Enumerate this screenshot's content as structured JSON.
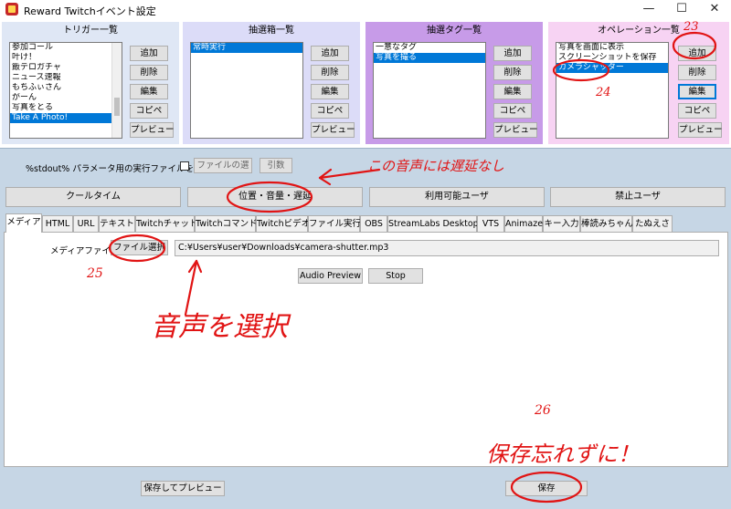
{
  "window": {
    "title": "Reward Twitchイベント設定",
    "controls": [
      "—",
      "☐",
      "✕"
    ]
  },
  "panels": [
    {
      "id": "trigger",
      "header": "トリガー一覧",
      "color": "#dfe7f5",
      "items": [
        "参加コール",
        "叶け！",
        "飯テロガチャ",
        "ニュース速報",
        "もちふぃさん",
        "がーん",
        "写真をとる",
        "Take A Photo!"
      ],
      "selected": 7,
      "buttons": [
        "追加",
        "削除",
        "編集",
        "コピペ",
        "プレビュー"
      ]
    },
    {
      "id": "lottery-box",
      "header": "抽選箱一覧",
      "color": "#dcdcf8",
      "items": [
        "常時実行"
      ],
      "selected": 0,
      "buttons": [
        "追加",
        "削除",
        "編集",
        "コピペ",
        "プレビュー"
      ]
    },
    {
      "id": "lottery-tag",
      "header": "抽選タグ一覧",
      "color": "#c79be8",
      "items": [
        "一意なタグ",
        "写真を撮る"
      ],
      "selected": 1,
      "buttons": [
        "追加",
        "削除",
        "編集",
        "コピペ",
        "プレビュー"
      ]
    },
    {
      "id": "operation",
      "header": "オペレーション一覧",
      "color": "#f7d3f3",
      "items": [
        "写真を画面に表示",
        "スクリーンショットを保存",
        "カメラシャッター"
      ],
      "selected": 2,
      "buttons": [
        "追加",
        "削除",
        "編集",
        "コピペ",
        "プレビュー"
      ]
    }
  ],
  "stdout_row": {
    "label": "%stdout% パラメータ用の実行ファイルを使う",
    "file_button": "ファイルの選",
    "arg_button": "引数"
  },
  "big_buttons": [
    "クールタイム",
    "位置・音量・遅延",
    "利用可能ユーザ",
    "禁止ユーザ"
  ],
  "tabs": [
    "メディア",
    "HTML",
    "URL",
    "テキスト",
    "Twitchチャット",
    "Twitchコマンド",
    "Twitchビデオ",
    "ファイル実行",
    "OBS",
    "StreamLabs Desktop",
    "VTS",
    "Animaze",
    "キー入力",
    "棒読みちゃん",
    "たぬえさ"
  ],
  "active_tab": 0,
  "media": {
    "label": "メディアファイル",
    "select_button": "ファイル選択",
    "path": "C:¥Users¥user¥Downloads¥camera-shutter.mp3",
    "preview_button": "Audio Preview",
    "stop_button": "Stop"
  },
  "footer": {
    "save_preview_button": "保存してプレビュー",
    "save_button": "保存"
  },
  "annotations": {
    "n23": "23",
    "n24": "24",
    "n25": "25",
    "n26": "26",
    "no_delay": "この音声には遅延なし",
    "select_audio": "音声を選択",
    "dont_forget": "保存忘れずに！",
    "color": "#e11414"
  }
}
